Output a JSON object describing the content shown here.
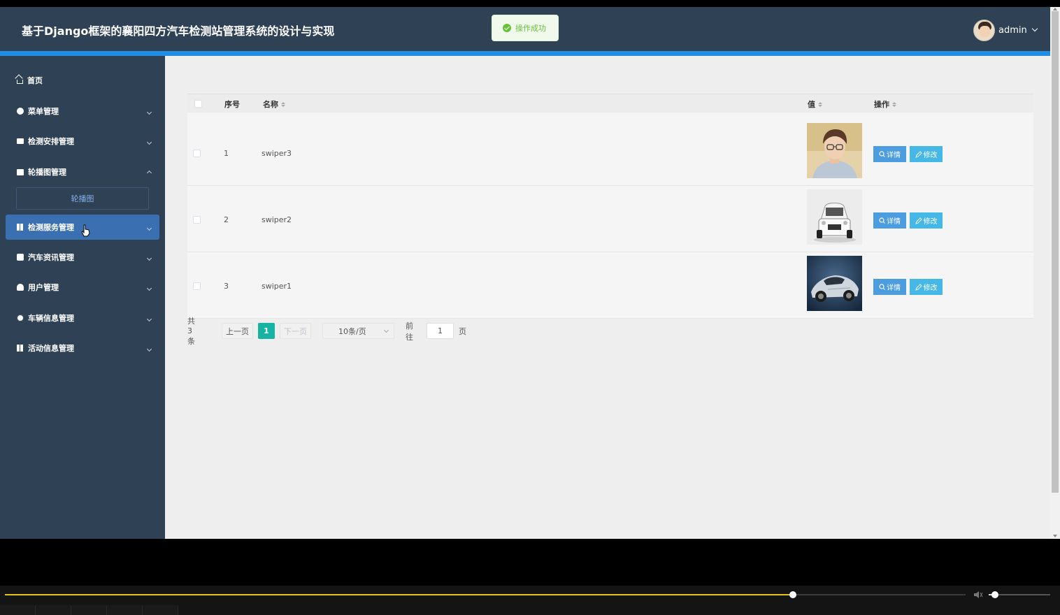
{
  "header": {
    "title": "基于Django框架的襄阳四方汽车检测站管理系统的设计与实现",
    "toast": "操作成功",
    "user": "admin"
  },
  "sidebar": {
    "items": [
      {
        "label": "首页",
        "icon": "home-icon"
      },
      {
        "label": "菜单管理",
        "icon": "circle-icon"
      },
      {
        "label": "检测安排管理",
        "icon": "print-icon"
      },
      {
        "label": "轮播图管理",
        "icon": "bag-icon"
      },
      {
        "label": "检测服务管理",
        "icon": "grid-icon"
      },
      {
        "label": "汽车资讯管理",
        "icon": "puzzle-icon"
      },
      {
        "label": "用户管理",
        "icon": "user-icon"
      },
      {
        "label": "车辆信息管理",
        "icon": "gear-icon"
      },
      {
        "label": "活动信息管理",
        "icon": "grid-icon"
      }
    ],
    "sub_item": "轮播图"
  },
  "table": {
    "columns": [
      "序号",
      "名称",
      "值",
      "操作"
    ],
    "rows": [
      {
        "index": "1",
        "name": "swiper3",
        "image": "portrait"
      },
      {
        "index": "2",
        "name": "swiper2",
        "image": "white-car"
      },
      {
        "index": "3",
        "name": "swiper1",
        "image": "silver-sports-car"
      }
    ],
    "detail_label": "详情",
    "edit_label": "修改"
  },
  "pagination": {
    "total": "共 3 条",
    "prev": "上一页",
    "current": "1",
    "next": "下一页",
    "page_size": "10条/页",
    "goto_prefix": "前往",
    "goto_value": "1",
    "goto_suffix": "页"
  },
  "player": {
    "progress": 0.82,
    "volume": 0.1
  },
  "colors": {
    "header": "#2f4155",
    "accent_stripe": "#1f8de3",
    "active_menu": "#3a6fb2",
    "pager_current": "#17b3a3",
    "detail_button": "#4c9ce0",
    "edit_button": "#45b8e8",
    "progress": "#e3c21a"
  }
}
